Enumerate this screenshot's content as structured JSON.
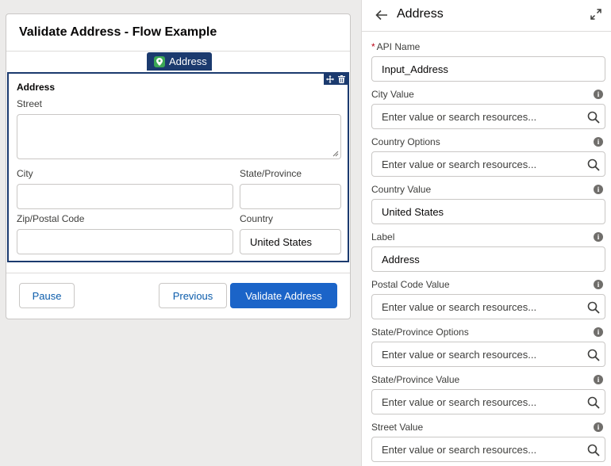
{
  "canvas": {
    "card_title": "Validate Address - Flow Example",
    "component_tab_label": "Address",
    "address_heading": "Address",
    "fields": {
      "street_label": "Street",
      "city_label": "City",
      "state_label": "State/Province",
      "zip_label": "Zip/Postal Code",
      "country_label": "Country",
      "country_value": "United States"
    },
    "buttons": {
      "pause": "Pause",
      "previous": "Previous",
      "validate": "Validate Address"
    }
  },
  "panel": {
    "title": "Address",
    "properties": [
      {
        "label": "API Name",
        "required": "*",
        "value": "Input_Address",
        "placeholder": "",
        "info": false,
        "search": false
      },
      {
        "label": "City Value",
        "required": "",
        "value": "",
        "placeholder": "Enter value or search resources...",
        "info": true,
        "search": true
      },
      {
        "label": "Country Options",
        "required": "",
        "value": "",
        "placeholder": "Enter value or search resources...",
        "info": true,
        "search": true
      },
      {
        "label": "Country Value",
        "required": "",
        "value": "United States",
        "placeholder": "",
        "info": true,
        "search": false
      },
      {
        "label": "Label",
        "required": "",
        "value": "Address",
        "placeholder": "",
        "info": true,
        "search": false
      },
      {
        "label": "Postal Code Value",
        "required": "",
        "value": "",
        "placeholder": "Enter value or search resources...",
        "info": true,
        "search": true
      },
      {
        "label": "State/Province Options",
        "required": "",
        "value": "",
        "placeholder": "Enter value or search resources...",
        "info": true,
        "search": true
      },
      {
        "label": "State/Province Value",
        "required": "",
        "value": "",
        "placeholder": "Enter value or search resources...",
        "info": true,
        "search": true
      },
      {
        "label": "Street Value",
        "required": "",
        "value": "",
        "placeholder": "Enter value or search resources...",
        "info": true,
        "search": true
      }
    ]
  },
  "colors": {
    "brand": "#1b64c8",
    "selection_navy": "#1b3a6e",
    "link_blue": "#0b5cab",
    "required_red": "#ba0517"
  }
}
